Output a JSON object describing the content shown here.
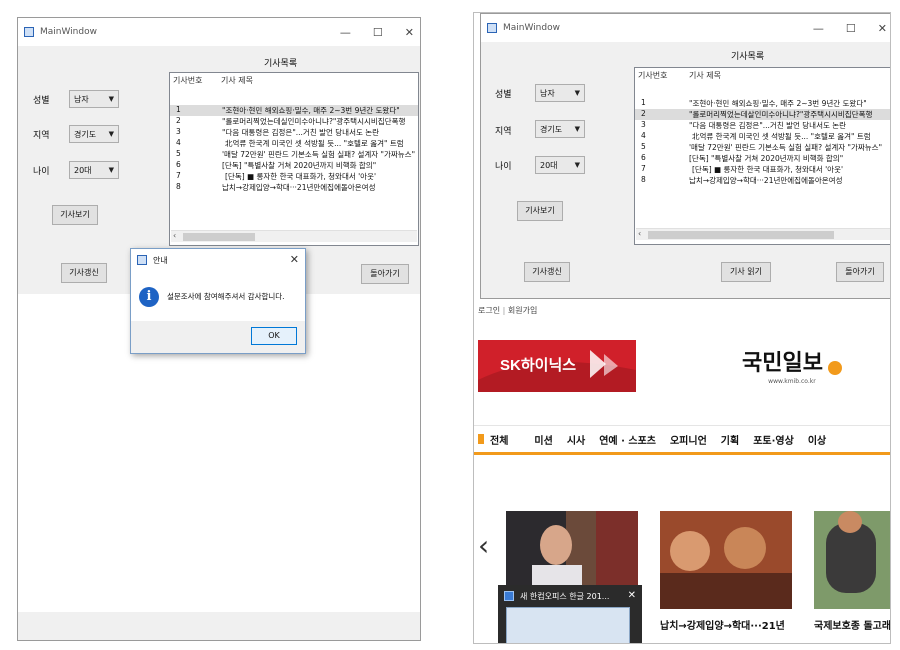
{
  "left_window": {
    "title": "MainWindow",
    "controls": {
      "minimize": "—",
      "maximize": "☐",
      "close": "✕"
    },
    "header": "기사목록",
    "form": {
      "gender_label": "성별",
      "gender_value": "남자",
      "region_label": "지역",
      "region_value": "경기도",
      "age_label": "나이",
      "age_value": "20대"
    },
    "view_button": "기사보기",
    "update_button": "기사갱신",
    "back_button": "돌아가기",
    "list": {
      "columns": [
        "기사번호",
        "기사 제목"
      ],
      "rows": [
        {
          "no": "1",
          "title": "\"조현아·현민 해외쇼핑·밀수, 매주 2~3번 9년간 도왔다\""
        },
        {
          "no": "2",
          "title": "\"롤로머리찍었는데실인미수아니냐?\"광주택시시비집단폭행"
        },
        {
          "no": "3",
          "title": "\"다음 대통령은 김정은\"...거친 발언 당내서도 논란"
        },
        {
          "no": "4",
          "title": "北억류 한국계 미국인 셋 석방될 듯... \"호텔로 옮겨\" 트럼"
        },
        {
          "no": "5",
          "title": "'매달 72만원' 핀란드 기본소득 실험 실패? 설계자 \"가짜뉴스\""
        },
        {
          "no": "6",
          "title": "[단독] \"특별사찰 거쳐 2020년까지 비핵화 합의\""
        },
        {
          "no": "7",
          "title": "[단독] ■ 롱자한 한국 대표화가, 청와대서 '아웃'"
        },
        {
          "no": "8",
          "title": "납치→강제입양→학대···21년만에집에돌아온여성"
        }
      ]
    },
    "dialog": {
      "title": "안내",
      "close": "✕",
      "icon_letter": "i",
      "message": "설문조사에 참여해주셔서 감사합니다.",
      "ok": "OK"
    }
  },
  "right_window": {
    "title": "MainWindow",
    "controls": {
      "minimize": "—",
      "maximize": "☐",
      "close": "✕"
    },
    "header": "기사목록",
    "form": {
      "gender_label": "성별",
      "gender_value": "남자",
      "region_label": "지역",
      "region_value": "경기도",
      "age_label": "나이",
      "age_value": "20대"
    },
    "view_button": "기사보기",
    "update_button": "기사갱신",
    "read_button": "기사 읽기",
    "back_button": "돌아가기",
    "list": {
      "columns": [
        "기사번호",
        "기사 제목"
      ],
      "rows": [
        {
          "no": "1",
          "title": "\"조현아·현민 해외쇼핑·밀수, 매주 2~3번 9년간 도왔다\""
        },
        {
          "no": "2",
          "title": "\"롤로머리찍었는데살인미수아니냐?\"광주택시시비집단폭행"
        },
        {
          "no": "3",
          "title": "\"다음 대통령은 김정은\"...거친 발언 당내서도 논란"
        },
        {
          "no": "4",
          "title": "北억류 한국계 미국인 셋 석방될 듯... \"호텔로 옮겨\" 트럼"
        },
        {
          "no": "5",
          "title": "'매달 72만원' 핀란드 기본소득 실험 실패? 설계자 \"가짜뉴스\""
        },
        {
          "no": "6",
          "title": "[단독] \"특별사찰 거쳐 2020년까지 비핵화 합의\""
        },
        {
          "no": "7",
          "title": "[단독] ■ 롱자한 한국 대표화가, 청와대서 '아웃'"
        },
        {
          "no": "8",
          "title": "납치→강제입양→학대···21년만에집에돌아온여성"
        }
      ]
    }
  },
  "browser": {
    "login": "로그인",
    "signup": "회원가입",
    "ad_text": "SK하이닉스",
    "logo_text": "국민일보",
    "logo_url": "www.kmib.co.kr",
    "nav": [
      "전체",
      "미션",
      "시사",
      "연예 · 스포츠",
      "오피니언",
      "기획",
      "포토·영상",
      "이상"
    ],
    "prev_arrow": "‹",
    "captions": [
      "납치→강제입양→학대···21년",
      "국제보호종 돌고래"
    ],
    "taskbar_popup": "새 한컴오피스 한글 201...",
    "taskbar_close": "✕"
  },
  "colors": {
    "window_bg": "#f0f0f0",
    "accent_blue": "#0078d7",
    "info_icon": "#1e63c4",
    "ad_red": "#d0202a",
    "nav_orange": "#f29a1b"
  }
}
